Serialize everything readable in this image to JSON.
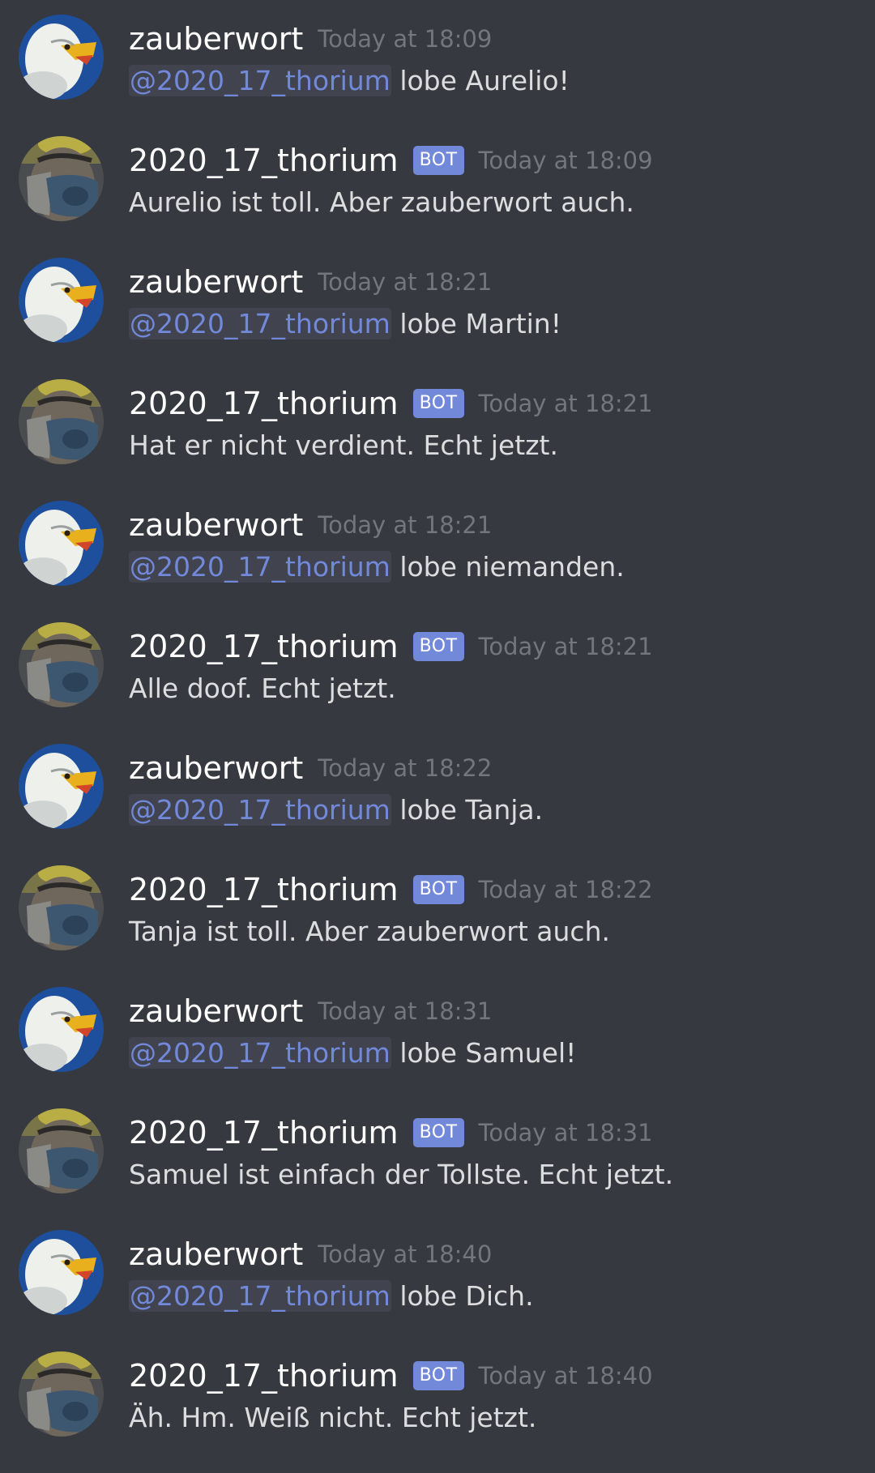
{
  "messages": [
    {
      "author": "zauberwort",
      "avatar": "eagle-avatar",
      "bot": false,
      "timestamp": "Today at 18:09",
      "mention": "@2020_17_thorium",
      "text": "lobe Aurelio!"
    },
    {
      "author": "2020_17_thorium",
      "avatar": "masked-face-avatar",
      "bot": true,
      "bot_label": "BOT",
      "timestamp": "Today at 18:09",
      "text": "Aurelio ist toll. Aber zauberwort auch."
    },
    {
      "author": "zauberwort",
      "avatar": "eagle-avatar",
      "bot": false,
      "timestamp": "Today at 18:21",
      "mention": "@2020_17_thorium",
      "text": "lobe Martin!"
    },
    {
      "author": "2020_17_thorium",
      "avatar": "masked-face-avatar",
      "bot": true,
      "bot_label": "BOT",
      "timestamp": "Today at 18:21",
      "text": "Hat er nicht verdient. Echt jetzt."
    },
    {
      "author": "zauberwort",
      "avatar": "eagle-avatar",
      "bot": false,
      "timestamp": "Today at 18:21",
      "mention": "@2020_17_thorium",
      "text": "lobe niemanden."
    },
    {
      "author": "2020_17_thorium",
      "avatar": "masked-face-avatar",
      "bot": true,
      "bot_label": "BOT",
      "timestamp": "Today at 18:21",
      "text": "Alle doof. Echt jetzt."
    },
    {
      "author": "zauberwort",
      "avatar": "eagle-avatar",
      "bot": false,
      "timestamp": "Today at 18:22",
      "mention": "@2020_17_thorium",
      "text": "lobe Tanja."
    },
    {
      "author": "2020_17_thorium",
      "avatar": "masked-face-avatar",
      "bot": true,
      "bot_label": "BOT",
      "timestamp": "Today at 18:22",
      "text": "Tanja ist toll. Aber zauberwort auch."
    },
    {
      "author": "zauberwort",
      "avatar": "eagle-avatar",
      "bot": false,
      "timestamp": "Today at 18:31",
      "mention": "@2020_17_thorium",
      "text": "lobe Samuel!"
    },
    {
      "author": "2020_17_thorium",
      "avatar": "masked-face-avatar",
      "bot": true,
      "bot_label": "BOT",
      "timestamp": "Today at 18:31",
      "text": "Samuel ist einfach der Tollste. Echt jetzt."
    },
    {
      "author": "zauberwort",
      "avatar": "eagle-avatar",
      "bot": false,
      "timestamp": "Today at 18:40",
      "mention": "@2020_17_thorium",
      "text": "lobe Dich."
    },
    {
      "author": "2020_17_thorium",
      "avatar": "masked-face-avatar",
      "bot": true,
      "bot_label": "BOT",
      "timestamp": "Today at 18:40",
      "text": "Äh. Hm. Weiß nicht. Echt jetzt."
    }
  ]
}
